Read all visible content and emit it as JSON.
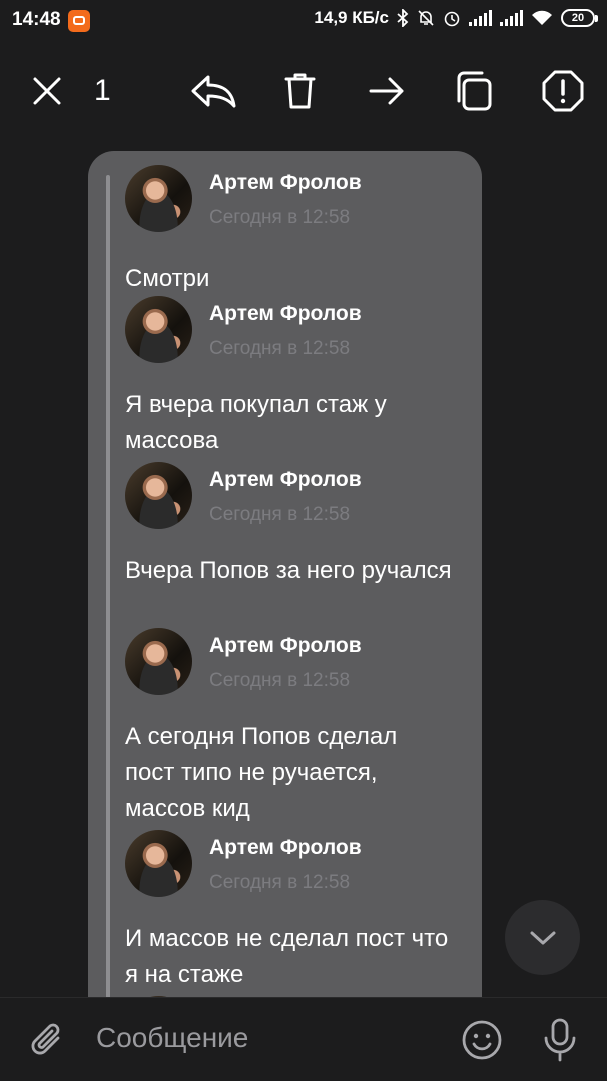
{
  "status_bar": {
    "time": "14:48",
    "net_speed": "14,9 КБ/с",
    "battery": "20",
    "icons": [
      "app-notification-icon",
      "bluetooth-icon",
      "mute-icon",
      "alarm-icon",
      "signal-icon",
      "signal-icon",
      "wifi-icon",
      "battery-icon"
    ]
  },
  "toolbar": {
    "selected_count": "1",
    "icons": [
      "close-icon",
      "reply-icon",
      "delete-icon",
      "forward-icon",
      "copy-icon",
      "report-icon"
    ]
  },
  "messages": [
    {
      "author": "Артем Фролов",
      "time": "Сегодня в 12:58",
      "text": "Смотри"
    },
    {
      "author": "Артем Фролов",
      "time": "Сегодня в 12:58",
      "text": "Я вчера покупал стаж у массова"
    },
    {
      "author": "Артем Фролов",
      "time": "Сегодня в 12:58",
      "text": "Вчера Попов за него ручался"
    },
    {
      "author": "Артем Фролов",
      "time": "Сегодня в 12:58",
      "text": "А сегодня Попов сделал пост типо не ручается, массов кид"
    },
    {
      "author": "Артем Фролов",
      "time": "Сегодня в 12:58",
      "text": "И массов не сделал пост что я на стаже"
    }
  ],
  "compose": {
    "placeholder": "Сообщение",
    "icons": [
      "attach-icon",
      "emoji-icon",
      "microphone-icon"
    ]
  },
  "colors": {
    "background": "#1c1c1d",
    "bubble": "#5c5c5e",
    "timestamp": "#7c7c80"
  }
}
